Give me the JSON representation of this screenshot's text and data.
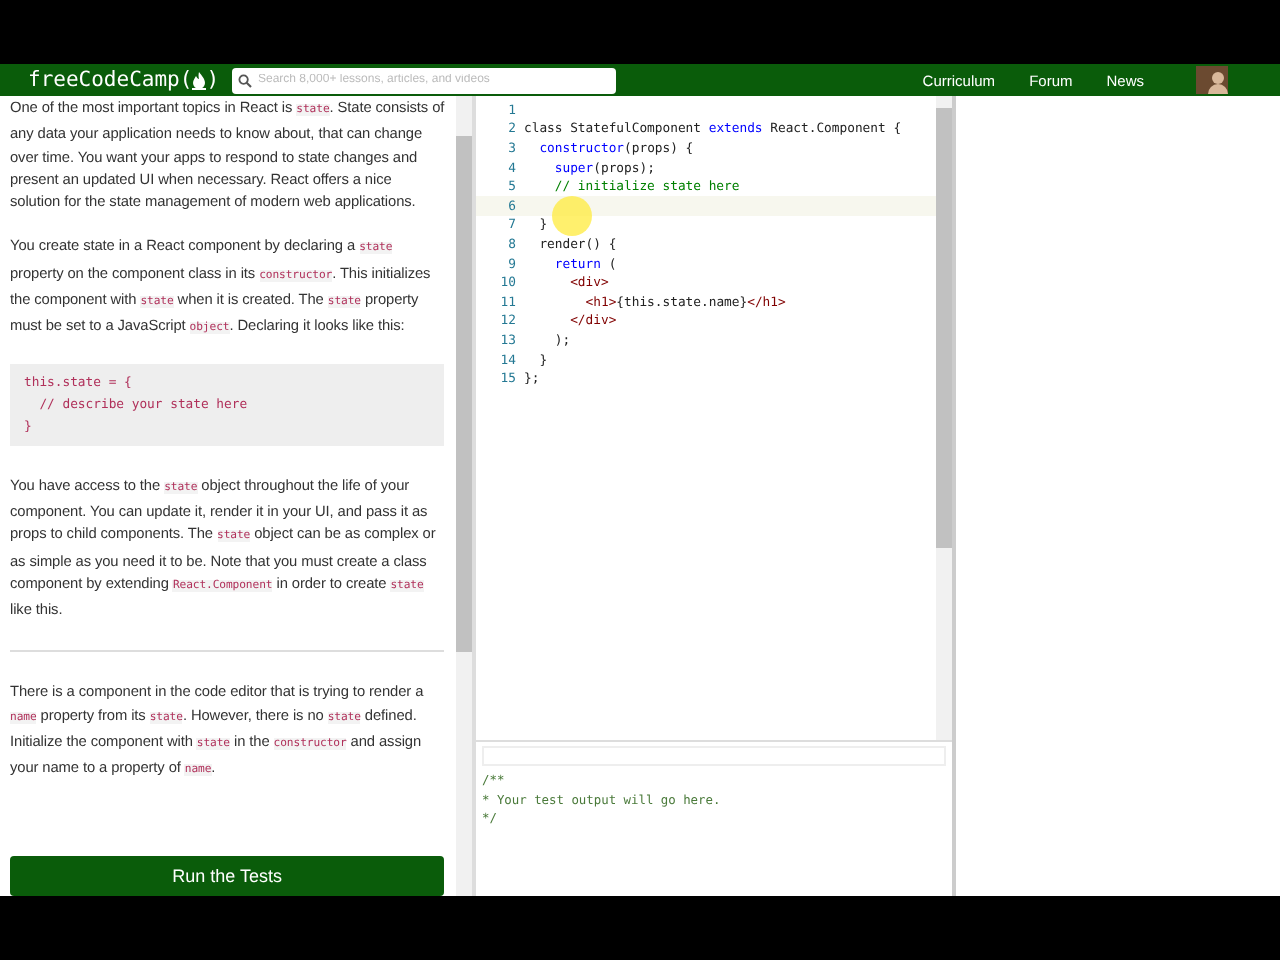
{
  "navbar": {
    "logo": {
      "text": "freeCodeCamp",
      "brackets": [
        "(",
        ")"
      ]
    },
    "search": {
      "placeholder": "Search 8,000+ lessons, articles, and videos"
    },
    "links": [
      "Curriculum",
      "Forum",
      "News"
    ]
  },
  "lesson": {
    "blocks": [
      {
        "kind": "para",
        "parts": [
          {
            "text": "One of the most important topics in React is ",
            "kind": "text"
          },
          {
            "text": "state",
            "kind": "code"
          },
          {
            "text": ". State consists of any data your application needs to know about, that can change over time. You want your apps to respond to state changes and present an updated UI when necessary. React offers a nice solution for the state management of modern web applications.",
            "kind": "text"
          }
        ]
      },
      {
        "kind": "para",
        "parts": [
          {
            "text": "You create state in a React component by declaring a ",
            "kind": "text"
          },
          {
            "text": "state",
            "kind": "code"
          },
          {
            "text": " property on the component class in its ",
            "kind": "text"
          },
          {
            "text": "constructor",
            "kind": "code"
          },
          {
            "text": ". This initializes the component with ",
            "kind": "text"
          },
          {
            "text": "state",
            "kind": "code"
          },
          {
            "text": " when it is created. The ",
            "kind": "text"
          },
          {
            "text": "state",
            "kind": "code"
          },
          {
            "text": " property must be set to a JavaScript ",
            "kind": "text"
          },
          {
            "text": "object",
            "kind": "code"
          },
          {
            "text": ". Declaring it looks like this:",
            "kind": "text"
          }
        ]
      },
      {
        "kind": "code",
        "lines": [
          "this.state = {",
          "  // describe your state here",
          "}"
        ]
      },
      {
        "kind": "para",
        "parts": [
          {
            "text": "You have access to the ",
            "kind": "text"
          },
          {
            "text": "state",
            "kind": "code"
          },
          {
            "text": " object throughout the life of your component. You can update it, render it in your UI, and pass it as props to child components. The ",
            "kind": "text"
          },
          {
            "text": "state",
            "kind": "code"
          },
          {
            "text": " object can be as complex or as simple as you need it to be. Note that you must create a class component by extending ",
            "kind": "text"
          },
          {
            "text": "React.Component",
            "kind": "code"
          },
          {
            "text": " in order to create ",
            "kind": "text"
          },
          {
            "text": "state",
            "kind": "code"
          },
          {
            "text": " like this.",
            "kind": "text"
          }
        ]
      },
      {
        "kind": "rule"
      },
      {
        "kind": "para",
        "parts": [
          {
            "text": "There is a component in the code editor that is trying to render a ",
            "kind": "text"
          },
          {
            "text": "name",
            "kind": "code"
          },
          {
            "text": " property from its ",
            "kind": "text"
          },
          {
            "text": "state",
            "kind": "code"
          },
          {
            "text": ". However, there is no ",
            "kind": "text"
          },
          {
            "text": "state",
            "kind": "code"
          },
          {
            "text": " defined. Initialize the component with ",
            "kind": "text"
          },
          {
            "text": "state",
            "kind": "code"
          },
          {
            "text": " in the ",
            "kind": "text"
          },
          {
            "text": "constructor",
            "kind": "code"
          },
          {
            "text": " and assign your name to a property of ",
            "kind": "text"
          },
          {
            "text": "name",
            "kind": "code"
          },
          {
            "text": ".",
            "kind": "text"
          }
        ]
      }
    ],
    "run_button": "Run the Tests"
  },
  "editor": {
    "lines": [
      {
        "number": "1"
      },
      {
        "number": "2",
        "tokens": [
          {
            "t": "class StatefulComponent ",
            "kind": "plain"
          },
          {
            "t": "extends",
            "kind": "keyword"
          },
          {
            "t": " React.Component {",
            "kind": "plain"
          }
        ]
      },
      {
        "number": "3",
        "tokens": [
          {
            "t": "  constructor",
            "kind": "keyword"
          },
          {
            "t": "(props) {",
            "kind": "plain"
          }
        ]
      },
      {
        "number": "4",
        "tokens": [
          {
            "t": "    super",
            "kind": "keyword"
          },
          {
            "t": "(props);",
            "kind": "plain"
          }
        ]
      },
      {
        "number": "5",
        "tokens": [
          {
            "t": "    // initialize state here",
            "kind": "comment"
          }
        ]
      },
      {
        "number": "6"
      },
      {
        "number": "7",
        "tokens": [
          {
            "t": "  }",
            "kind": "plain"
          }
        ]
      },
      {
        "number": "8",
        "tokens": [
          {
            "t": "  render() {",
            "kind": "plain"
          }
        ]
      },
      {
        "number": "9",
        "tokens": [
          {
            "t": "    return",
            "kind": "keyword"
          },
          {
            "t": " (",
            "kind": "plain"
          }
        ]
      },
      {
        "number": "10",
        "tokens": [
          {
            "t": "      <div>",
            "kind": "tag"
          }
        ]
      },
      {
        "number": "11",
        "tokens": [
          {
            "t": "        <h1>",
            "kind": "tag"
          },
          {
            "t": "{this.state.name}",
            "kind": "plain"
          },
          {
            "t": "</h1>",
            "kind": "tag"
          }
        ]
      },
      {
        "number": "12",
        "tokens": [
          {
            "t": "      </div>",
            "kind": "tag"
          }
        ]
      },
      {
        "number": "13",
        "tokens": [
          {
            "t": "    );",
            "kind": "plain"
          }
        ]
      },
      {
        "number": "14",
        "tokens": [
          {
            "t": "  }",
            "kind": "plain"
          }
        ]
      },
      {
        "number": "15",
        "tokens": [
          {
            "t": "};",
            "kind": "plain"
          }
        ]
      }
    ]
  },
  "output": {
    "lines": [
      "/**",
      "* Your test output will go here.",
      "*/"
    ]
  }
}
